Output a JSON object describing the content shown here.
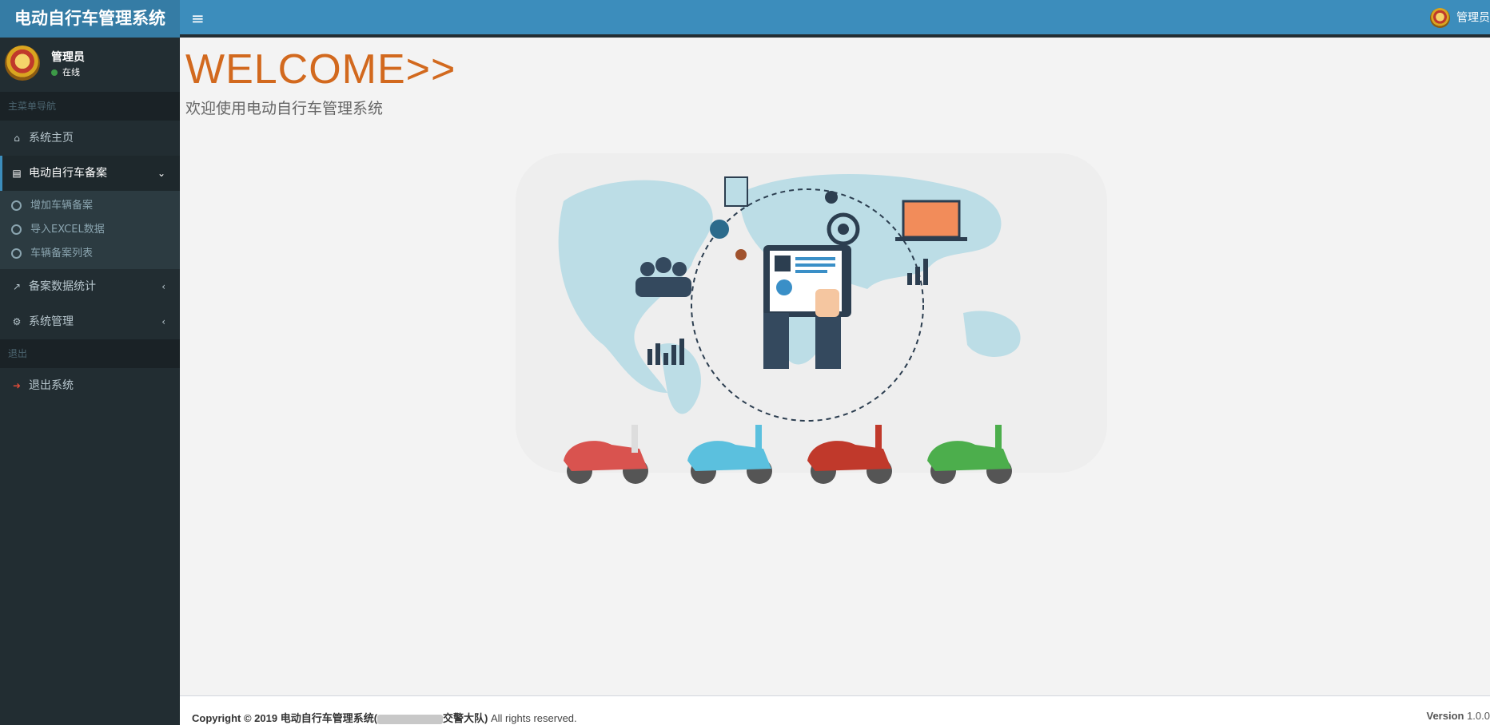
{
  "app": {
    "title": "电动自行车管理系统"
  },
  "user": {
    "name": "管理员",
    "status": "在线"
  },
  "topbar": {
    "user_name": "管理员"
  },
  "sidebar": {
    "section_main": "主菜单导航",
    "home": "系统主页",
    "ebike_record": "电动自行车备案",
    "sub_items": [
      "增加车辆备案",
      "导入EXCEL数据",
      "车辆备案列表"
    ],
    "stats": "备案数据统计",
    "system": "系统管理",
    "section_exit": "退出",
    "logout": "退出系统"
  },
  "main": {
    "welcome": "WELCOME>>",
    "subtitle": "欢迎使用电动自行车管理系统"
  },
  "footer": {
    "copyright_prefix": "Copyright © 2019 电动自行车管理系统(",
    "copyright_suffix": "交警大队)",
    "rights": " All rights reserved.",
    "version_label": "Version",
    "version": "1.0.0"
  },
  "colors": {
    "brand": "#357ca5",
    "topbar": "#3c8dbc",
    "sidebar": "#222d32",
    "welcome": "#d2691e"
  },
  "icons": {
    "home": "home-icon",
    "file": "file-icon",
    "chart": "chart-icon",
    "gear": "gear-icon",
    "logout": "logout-icon",
    "menu": "bars-icon"
  }
}
